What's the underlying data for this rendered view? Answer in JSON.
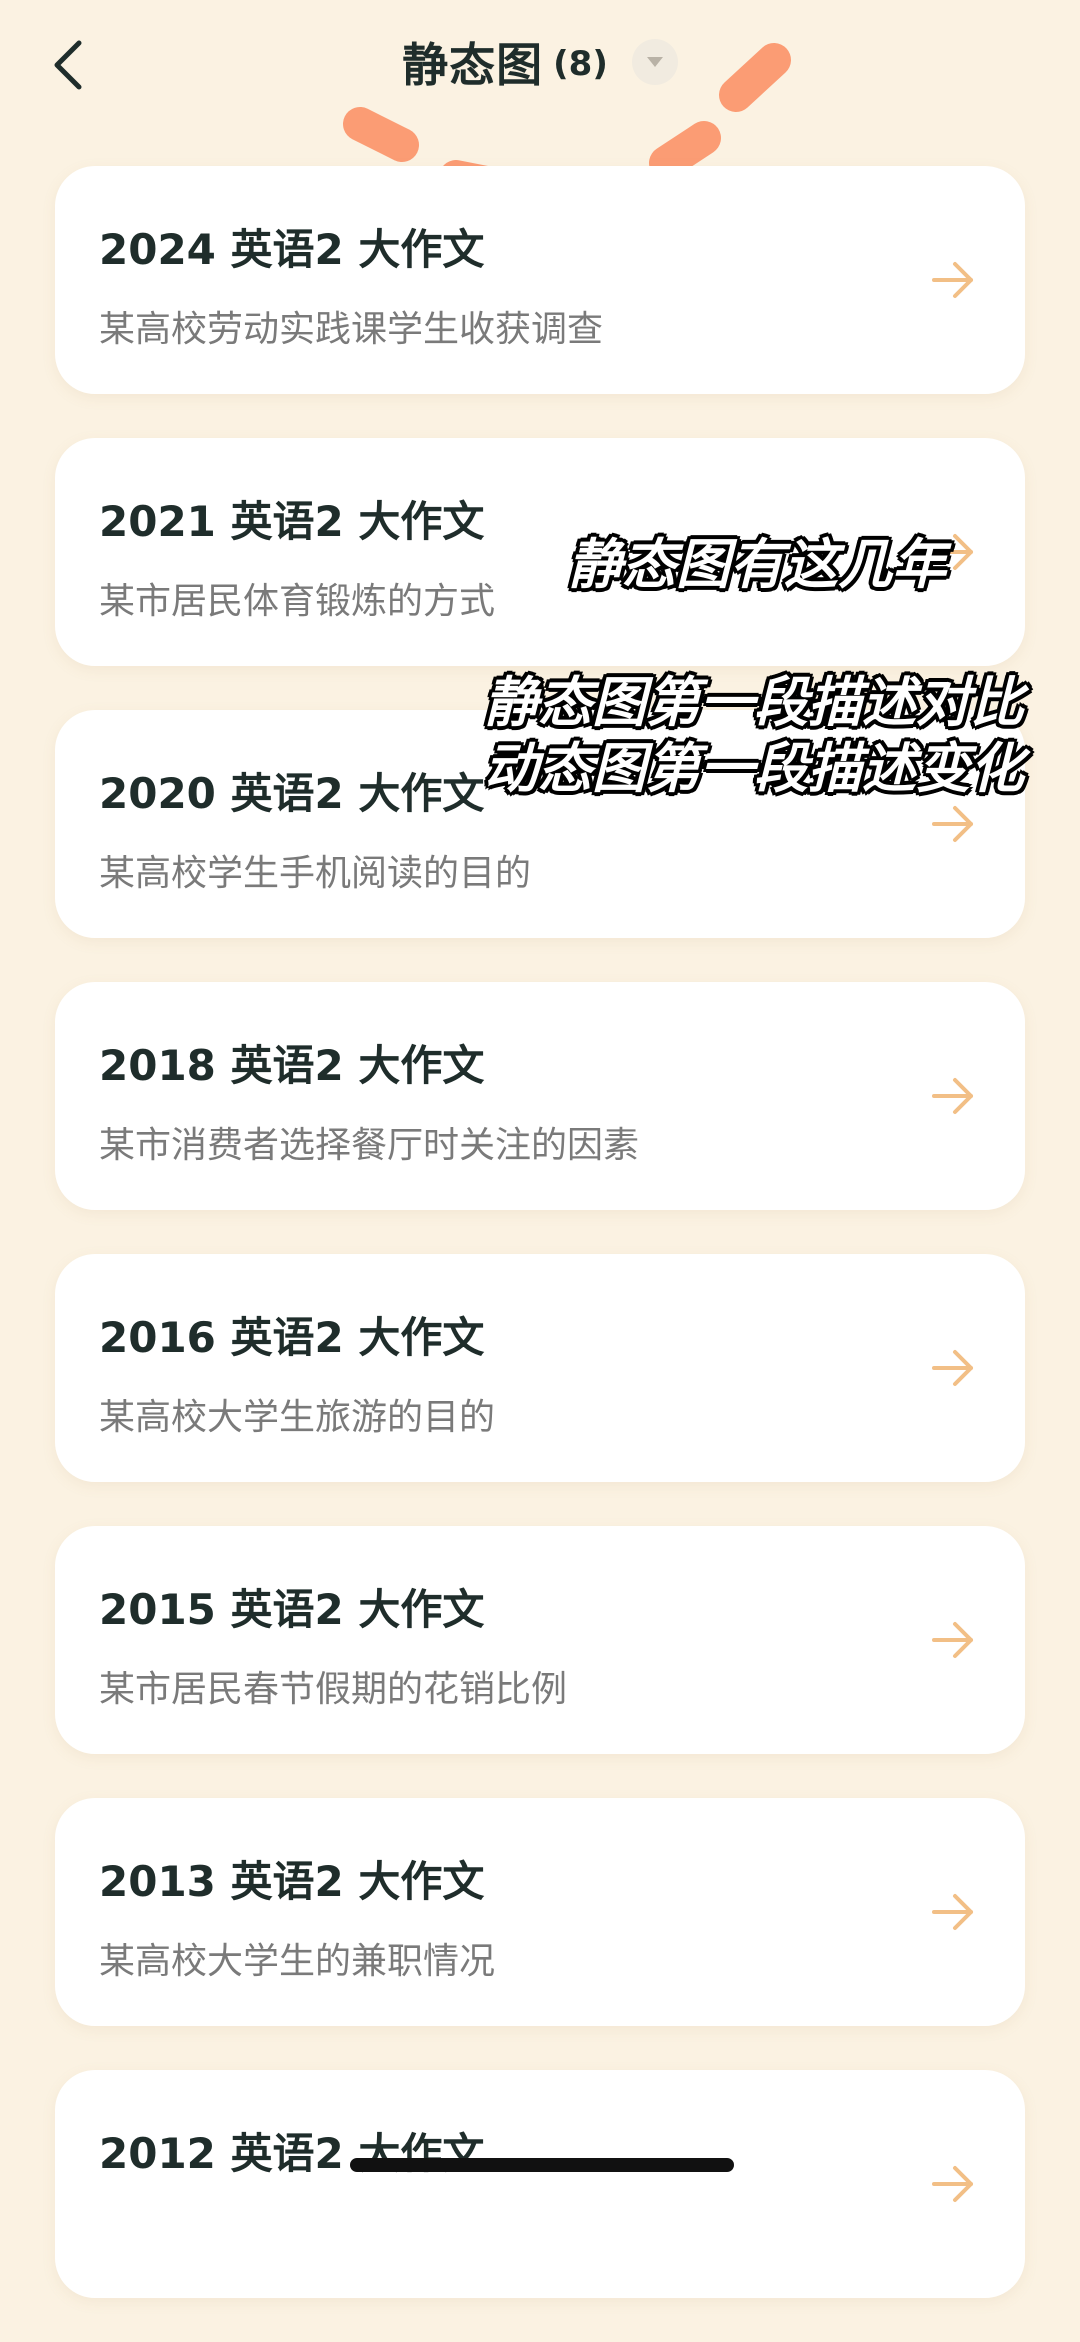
{
  "header": {
    "title": "静态图",
    "count": "(8)"
  },
  "items": [
    {
      "title": "2024 英语2 大作文",
      "subtitle": "某高校劳动实践课学生收获调查"
    },
    {
      "title": "2021 英语2 大作文",
      "subtitle": "某市居民体育锻炼的方式"
    },
    {
      "title": "2020 英语2 大作文",
      "subtitle": "某高校学生手机阅读的目的"
    },
    {
      "title": "2018 英语2 大作文",
      "subtitle": "某市消费者选择餐厅时关注的因素"
    },
    {
      "title": "2016 英语2 大作文",
      "subtitle": "某高校大学生旅游的目的"
    },
    {
      "title": "2015 英语2 大作文",
      "subtitle": "某市居民春节假期的花销比例"
    },
    {
      "title": "2013 英语2 大作文",
      "subtitle": "某高校大学生的兼职情况"
    },
    {
      "title": "2012 英语2 大作文",
      "subtitle": ""
    }
  ],
  "overlay": {
    "line1": "静态图有这几年",
    "line2": "静态图第一段描述对比",
    "line3": "动态图第一段描述变化"
  },
  "colors": {
    "background": "#fbf2e2",
    "card": "#ffffff",
    "arrow": "#f2bf86",
    "dash": "#fb9c74",
    "title_text": "#1f2d2b",
    "subtitle_text": "#7a7a7a"
  },
  "icons": {
    "back": "chevron-left-icon",
    "dropdown": "caret-down-icon",
    "item_arrow": "arrow-right-icon"
  }
}
